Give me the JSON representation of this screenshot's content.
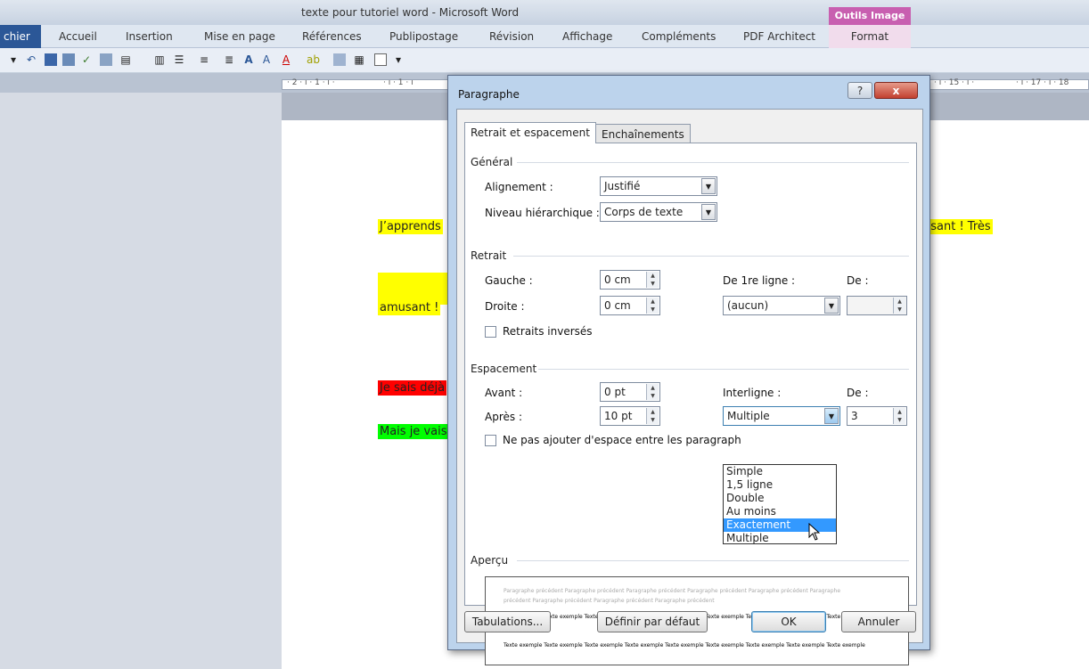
{
  "window": {
    "title": "texte pour tutoriel word  -  Microsoft Word",
    "context_label": "Outils Image"
  },
  "ribbon": {
    "tabs": [
      "chier",
      "Accueil",
      "Insertion",
      "Mise en page",
      "Références",
      "Publipostage",
      "Révision",
      "Affichage",
      "Compléments",
      "PDF Architect",
      "Format"
    ]
  },
  "ruler": {
    "left_ticks": "· 2 · ı · 1 · ı ·",
    "left_tick2": "· ı · 1 · ı",
    "right_ticks": "· ı · 15 · ı ·",
    "right_tick2": "· ı · 17 · ı · 18"
  },
  "document": {
    "lines": [
      {
        "text": "J’apprends",
        "bg": "#ffff00"
      },
      {
        "text": "amusant !",
        "bg": "#ffff00"
      },
      {
        "text": "Je sais déjà",
        "bg": "#ff0000"
      },
      {
        "text": "Mais je vais",
        "bg": "#00ff00"
      },
      {
        "text": "usant ! Très",
        "bg": "#ffff00"
      }
    ]
  },
  "dialog": {
    "title": "Paragraphe",
    "help_label": "?",
    "close_label": "x",
    "tabs": [
      "Retrait et espacement",
      "Enchaînements"
    ],
    "general": {
      "heading": "Général",
      "alignment_label": "Alignement :",
      "alignment_value": "Justifié",
      "level_label": "Niveau hiérarchique :",
      "level_value": "Corps de texte"
    },
    "indent": {
      "heading": "Retrait",
      "left_label": "Gauche :",
      "left_value": "0 cm",
      "right_label": "Droite :",
      "right_value": "0 cm",
      "first_line_label": "De 1re ligne :",
      "first_line_value": "(aucun)",
      "by_label": "De :",
      "by_value": "",
      "mirror_label": "Retraits inversés"
    },
    "spacing": {
      "heading": "Espacement",
      "before_label": "Avant :",
      "before_value": "0 pt",
      "after_label": "Après :",
      "after_value": "10 pt",
      "line_label": "Interligne :",
      "line_value": "Multiple",
      "at_label": "De :",
      "at_value": "3",
      "no_space_label": "Ne pas ajouter d'espace entre les paragraph",
      "options": [
        "Simple",
        "1,5 ligne",
        "Double",
        "Au moins",
        "Exactement",
        "Multiple"
      ],
      "highlighted": "Exactement"
    },
    "preview": {
      "heading": "Aperçu",
      "prev_line1": "Paragraphe précédent Paragraphe précédent Paragraphe précédent Paragraphe précédent Paragraphe précédent Paragraphe",
      "prev_line2": "précédent Paragraphe précédent Paragraphe précédent Paragraphe précédent",
      "sample1": "Texte exemple Texte exemple Texte exemple Texte exemple Texte exemple Texte exemple Texte exemple Texte exemple Texte exemple",
      "sample2": "Texte exemple Texte exemple Texte exemple Texte exemple Texte exemple Texte exemple Texte exemple Texte exemple Texte exemple"
    },
    "buttons": {
      "tabs": "Tabulations...",
      "default": "Définir par défaut",
      "ok": "OK",
      "cancel": "Annuler"
    }
  }
}
